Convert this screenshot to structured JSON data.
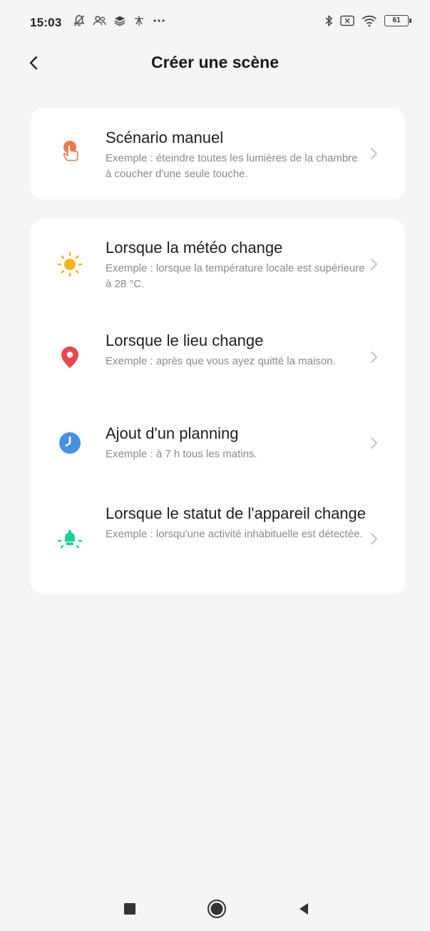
{
  "status_bar": {
    "time": "15:03",
    "left_icons": [
      "bell-muted-icon",
      "people-icon",
      "layers-icon",
      "sparkle-icon",
      "more-dots-icon"
    ],
    "right_icons": [
      "bluetooth-icon",
      "sim-card-icon",
      "wifi-icon"
    ],
    "battery_level": "61"
  },
  "header": {
    "title": "Créer une scène",
    "back_icon": "chevron-left-icon"
  },
  "card_manual": {
    "items": [
      {
        "title": "Scénario manuel",
        "description": "Exemple : éteindre toutes les lumières de la chambre à coucher d'une seule touche.",
        "icon": "hand-tap-icon",
        "icon_color": "#f0784a"
      }
    ]
  },
  "card_triggers": {
    "items": [
      {
        "title": "Lorsque la météo change",
        "description": "Exemple : lorsque la température locale est supérieure à 28 °C.",
        "icon": "sun-icon",
        "icon_color": "#f7b21c"
      },
      {
        "title": "Lorsque le lieu change",
        "description": "Exemple : après que vous ayez quitté la maison.",
        "icon": "location-pin-icon",
        "icon_color": "#e8474f"
      },
      {
        "title": "Ajout d'un planning",
        "description": "Exemple : à 7 h tous les matins.",
        "icon": "clock-icon",
        "icon_color": "#4a90e2"
      },
      {
        "title": "Lorsque le statut de l'appareil change",
        "description": "Exemple : lorsqu'une activité inhabituelle est détectée.",
        "icon": "device-bulb-icon",
        "icon_color": "#1fcf9a"
      }
    ]
  },
  "nav_bar": {
    "buttons": [
      "recent-apps-icon",
      "home-icon",
      "back-triangle-icon"
    ]
  }
}
